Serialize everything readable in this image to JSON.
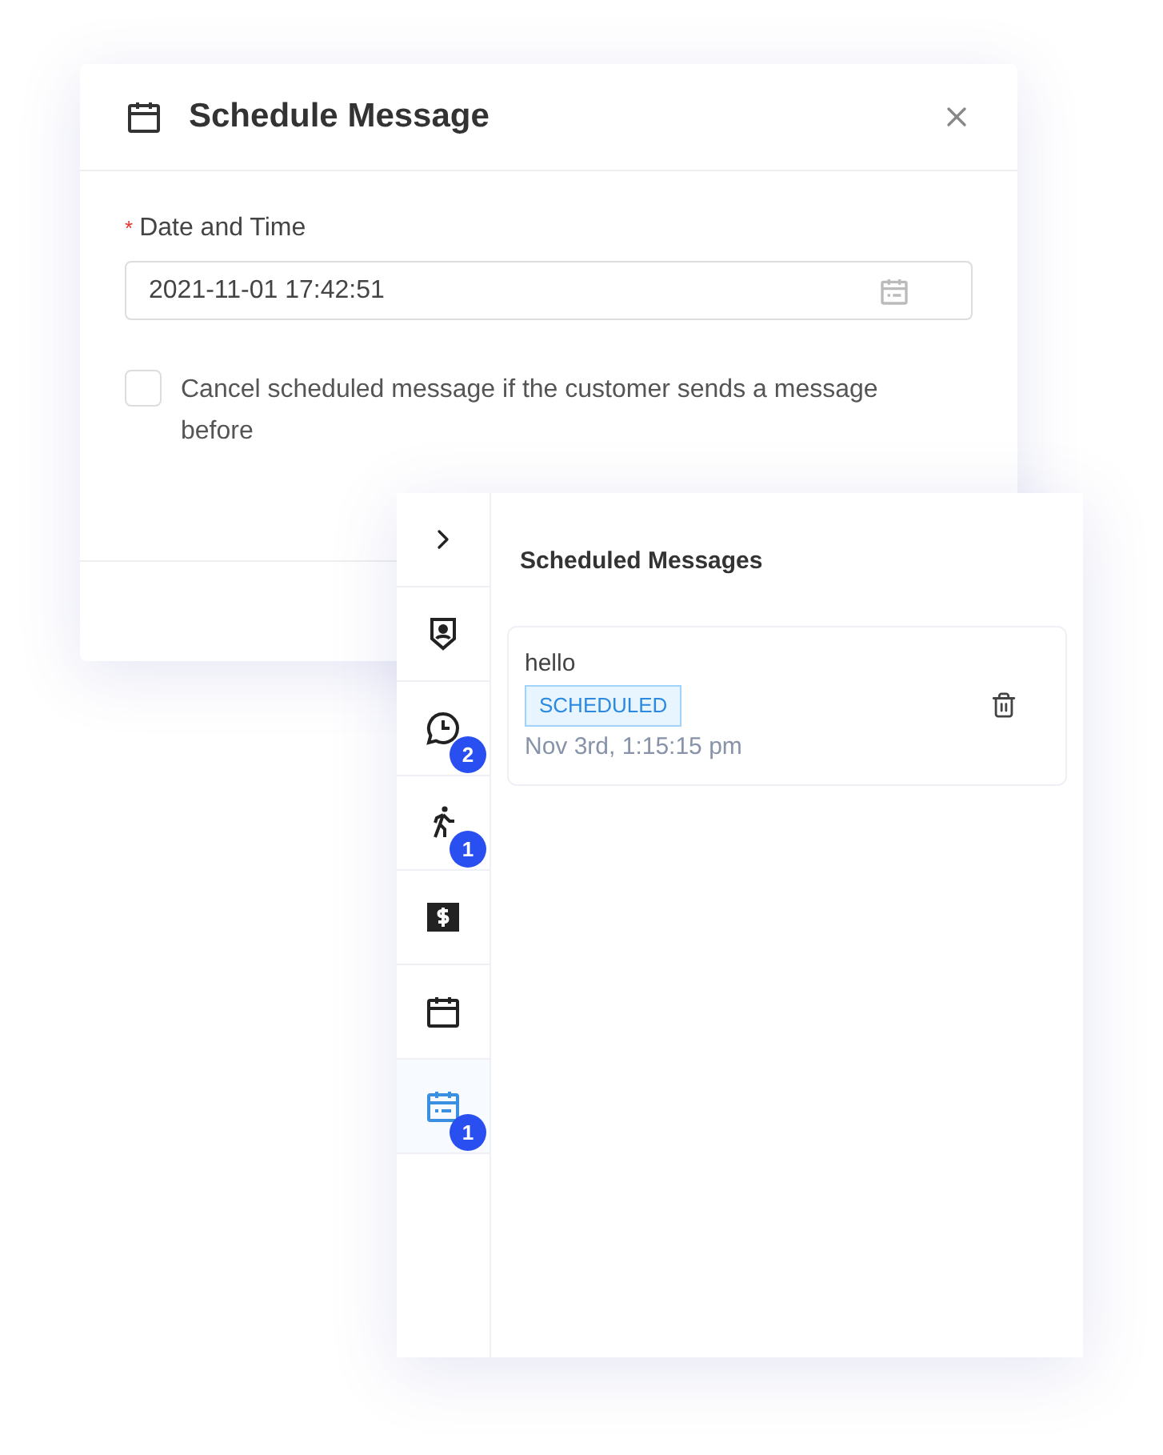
{
  "dialog": {
    "title": "Schedule Message",
    "field": {
      "label": "Date and Time",
      "required_mark": "*",
      "value": "2021-11-01 17:42:51"
    },
    "option": {
      "label": "Cancel scheduled message if the customer sends a message before",
      "checked": false
    }
  },
  "panel": {
    "sidebar": [
      {
        "kind": "collapse",
        "selected": false
      },
      {
        "kind": "contact",
        "selected": false
      },
      {
        "kind": "history",
        "selected": false,
        "badge": "2"
      },
      {
        "kind": "visitor",
        "selected": false,
        "badge": "1"
      },
      {
        "kind": "billing",
        "selected": false
      },
      {
        "kind": "calendar",
        "selected": false
      },
      {
        "kind": "scheduled",
        "selected": true,
        "badge": "1"
      }
    ],
    "title": "Scheduled Messages",
    "messages": [
      {
        "text": "hello",
        "status": "SCHEDULED",
        "time": "Nov 3rd, 1:15:15 pm"
      }
    ]
  }
}
